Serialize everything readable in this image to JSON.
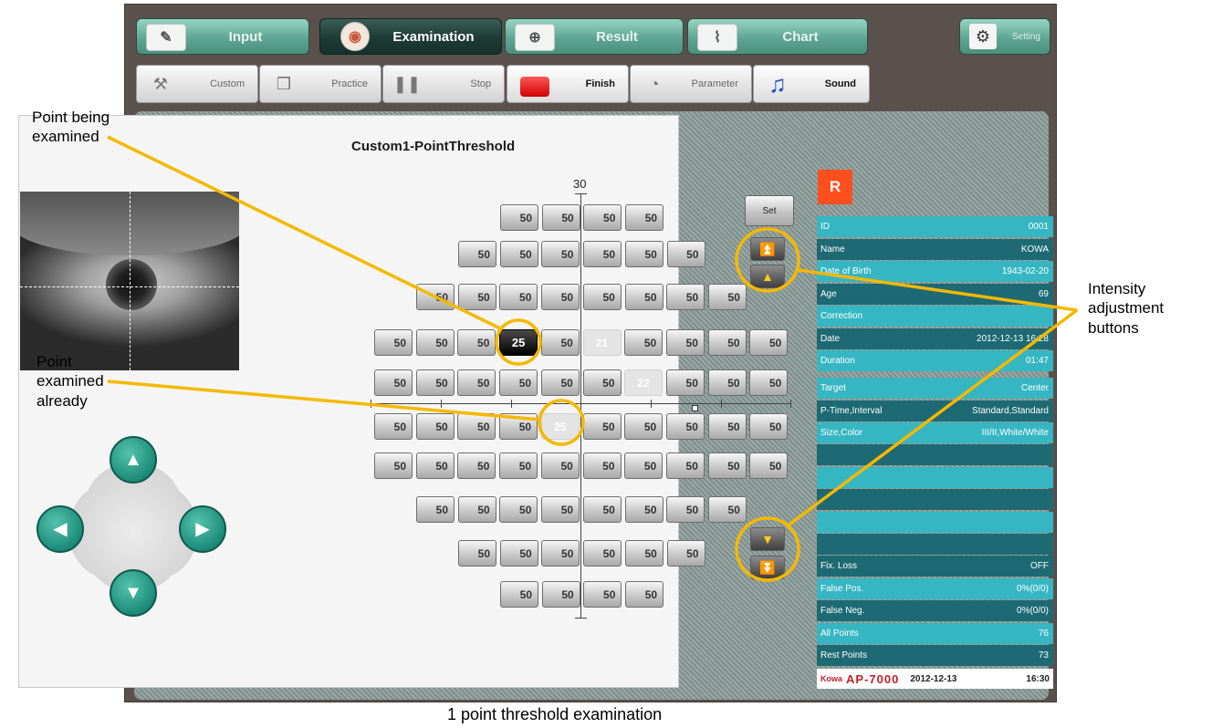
{
  "top_tabs": [
    {
      "label": "Input",
      "icon": "pen-icon"
    },
    {
      "label": "Examination",
      "icon": "eye-target-icon"
    },
    {
      "label": "Result",
      "icon": "visual-field-result-icon"
    },
    {
      "label": "Chart",
      "icon": "chart-icon"
    }
  ],
  "setting": {
    "label": "Setting",
    "icon": "gear-icon"
  },
  "toolbar": [
    {
      "label": "Custom",
      "icon": "wrench-icon"
    },
    {
      "label": "Practice",
      "icon": "book-icon"
    },
    {
      "label": "Stop",
      "icon": "pause-icon"
    },
    {
      "label": "Finish",
      "icon": "red-stop-icon"
    },
    {
      "label": "Parameter",
      "icon": "gauge-icon"
    },
    {
      "label": "Sound",
      "icon": "music-note-icon"
    }
  ],
  "exam": {
    "title": "Custom1-PointThreshold",
    "axis_label": "30",
    "set_label": "Set",
    "grid_rows": [
      [
        "50",
        "50",
        "50",
        "50"
      ],
      [
        "50",
        "50",
        "50",
        "50",
        "50",
        "50"
      ],
      [
        "50",
        "50",
        "50",
        "50",
        "50",
        "50",
        "50",
        "50"
      ],
      [
        "50",
        "50",
        "50",
        "25",
        "50",
        "21",
        "50",
        "50",
        "50",
        "50"
      ],
      [
        "50",
        "50",
        "50",
        "50",
        "50",
        "50",
        "22",
        "50",
        "50",
        "50"
      ],
      [
        "50",
        "50",
        "50",
        "50",
        "25",
        "50",
        "50",
        "50",
        "50",
        "50"
      ],
      [
        "50",
        "50",
        "50",
        "50",
        "50",
        "50",
        "50",
        "50",
        "50",
        "50"
      ],
      [
        "50",
        "50",
        "50",
        "50",
        "50",
        "50",
        "50",
        "50"
      ],
      [
        "50",
        "50",
        "50",
        "50",
        "50",
        "50"
      ],
      [
        "50",
        "50",
        "50",
        "50"
      ]
    ]
  },
  "info": {
    "eye": "R",
    "patient": [
      {
        "label": "ID",
        "value": "0001"
      },
      {
        "label": "Name",
        "value": "KOWA"
      },
      {
        "label": "Date of Birth",
        "value": "1943-02-20"
      },
      {
        "label": "Age",
        "value": "69"
      },
      {
        "label": "Correction",
        "value": ""
      },
      {
        "label": "Date",
        "value": "2012-12-13 16:28"
      },
      {
        "label": "Duration",
        "value": "01:47"
      }
    ],
    "settings": [
      {
        "label": "Target",
        "value": "Center"
      },
      {
        "label": "P-Time,Interval",
        "value": "Standard,Standard"
      },
      {
        "label": "Size,Color",
        "value": "III/II,White/White"
      }
    ],
    "stats": [
      {
        "label": "Fix. Loss",
        "value": "OFF"
      },
      {
        "label": "False Pos.",
        "value": "0%(0/0)"
      },
      {
        "label": "False Neg.",
        "value": "0%(0/0)"
      },
      {
        "label": "All Points",
        "value": "76"
      },
      {
        "label": "Rest Points",
        "value": "73"
      }
    ],
    "footer": {
      "brand_logo": "Kowa",
      "brand": "AP-7000",
      "date": "2012-12-13",
      "time": "16:30"
    }
  },
  "annotations": {
    "point_being_examined": "Point being examined",
    "point_examined_already": "Point examined already",
    "intensity_buttons": "Intensity adjustment buttons"
  },
  "caption": "1 point threshold examination",
  "colors": {
    "teal_tab": "#5fa593",
    "active_tab": "#1e3b35",
    "info_light": "#36b6c2",
    "info_dark": "#1d6a74",
    "eye_badge": "#ff4f1e",
    "annotation": "#f5b800"
  }
}
